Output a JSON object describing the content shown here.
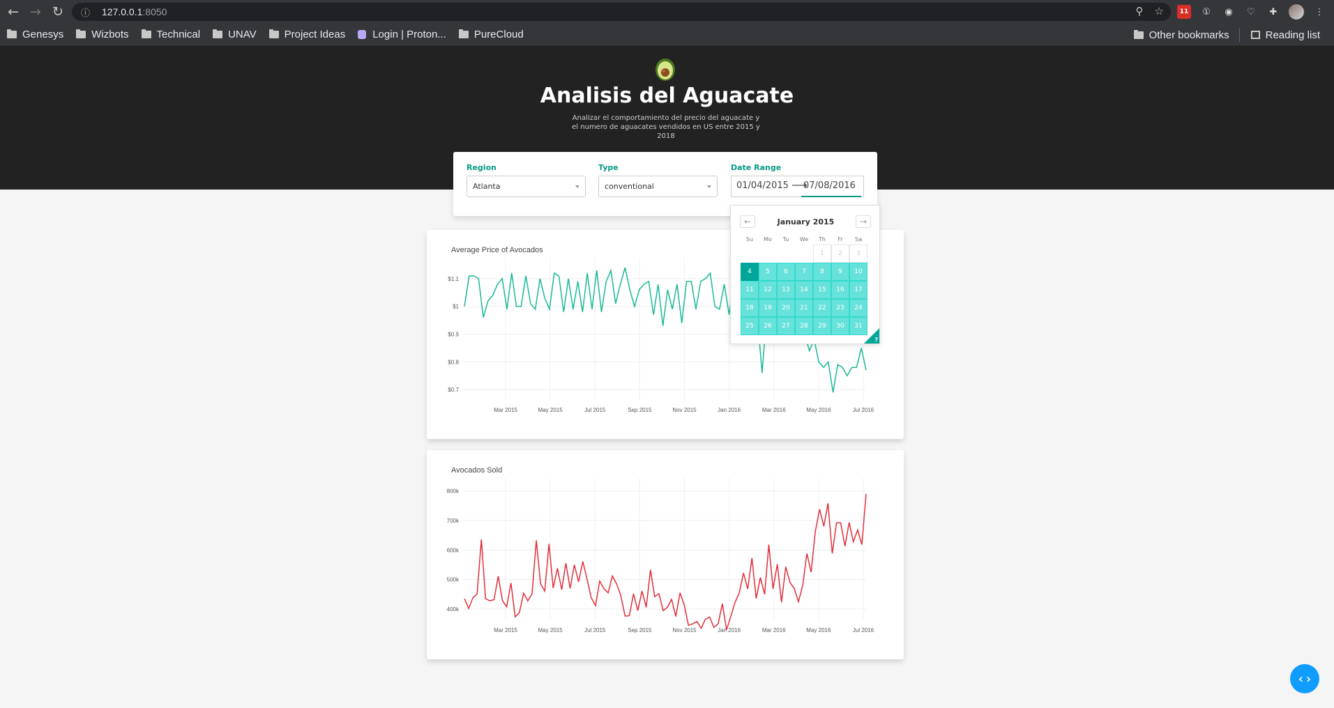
{
  "browser": {
    "url_host": "127.0.0.1",
    "url_port": ":8050",
    "calendar_badge": "11",
    "bookmarks": [
      "Genesys",
      "Wizbots",
      "Technical",
      "UNAV",
      "Project Ideas",
      "Login | Proton...",
      "PureCloud"
    ],
    "other_bookmarks": "Other bookmarks",
    "reading_list": "Reading list"
  },
  "header": {
    "title": "Analisis del Aguacate",
    "description": "Analizar el comportamiento del precio del aguacate y el numero de aguacates vendidos en US entre 2015 y 2018"
  },
  "menu": {
    "region_label": "Region",
    "region_value": "Atlanta",
    "type_label": "Type",
    "type_value": "conventional",
    "date_label": "Date Range",
    "start_date": "01/04/2015",
    "end_date": "07/08/2016"
  },
  "calendar": {
    "month_title": "January 2015",
    "prev_icon": "←",
    "next_icon": "→",
    "weekdays": [
      "Su",
      "Mo",
      "Tu",
      "We",
      "Th",
      "Fr",
      "Sa"
    ],
    "first_weekday_offset": 4,
    "days_in_month": 31,
    "selected_start": 4,
    "help_label": "?"
  },
  "fab_icon": "‹›",
  "chart_data": [
    {
      "type": "line",
      "title": "Average Price of Avocados",
      "color": "#17B897",
      "x_ticks": [
        "Mar 2015",
        "May 2015",
        "Jul 2015",
        "Sep 2015",
        "Nov 2015",
        "Jan 2016",
        "Mar 2016",
        "May 2016",
        "Jul 2016"
      ],
      "y_ticks": [
        "$0.7",
        "$0.8",
        "$0.9",
        "$1",
        "$1.1"
      ],
      "ylim": [
        0.66,
        1.15
      ],
      "values": [
        1.0,
        1.11,
        1.11,
        1.1,
        0.96,
        1.02,
        1.04,
        1.08,
        1.1,
        0.99,
        1.12,
        1.0,
        1.0,
        1.11,
        1.01,
        0.99,
        1.1,
        1.03,
        0.99,
        1.12,
        1.11,
        0.98,
        1.1,
        0.99,
        1.09,
        0.98,
        1.12,
        0.99,
        1.13,
        0.98,
        1.09,
        1.13,
        1.01,
        1.08,
        1.14,
        1.06,
        1.0,
        1.06,
        1.08,
        1.09,
        0.97,
        1.08,
        0.93,
        1.06,
        0.99,
        1.08,
        0.94,
        1.09,
        1.09,
        0.99,
        1.09,
        1.1,
        1.12,
        1.0,
        0.99,
        1.08,
        0.97,
        1.09,
        1.06,
        1.0,
        1.09,
        1.05,
        0.96,
        0.76,
        0.98,
        0.99,
        0.96,
        0.97,
        0.96,
        0.93,
        0.97,
        0.92,
        0.9,
        0.84,
        0.88,
        0.8,
        0.78,
        0.8,
        0.69,
        0.79,
        0.78,
        0.75,
        0.78,
        0.78,
        0.85,
        0.77
      ]
    },
    {
      "type": "line",
      "title": "Avocados Sold",
      "color": "#E12D39",
      "x_ticks": [
        "Mar 2015",
        "May 2015",
        "Jul 2015",
        "Sep 2015",
        "Nov 2015",
        "Jan 2016",
        "Mar 2016",
        "May 2016",
        "Jul 2016"
      ],
      "y_ticks": [
        "400k",
        "500k",
        "600k",
        "700k",
        "800k"
      ],
      "ylim": [
        360000,
        820000
      ],
      "values": [
        435000,
        402000,
        438000,
        452000,
        636000,
        435000,
        428000,
        432000,
        511000,
        428000,
        408000,
        488000,
        374000,
        388000,
        454000,
        428000,
        452000,
        633000,
        486000,
        461000,
        621000,
        471000,
        538000,
        466000,
        555000,
        470000,
        550000,
        492000,
        561000,
        502000,
        438000,
        412000,
        495000,
        469000,
        455000,
        512000,
        485000,
        445000,
        376000,
        378000,
        452000,
        395000,
        461000,
        406000,
        533000,
        442000,
        452000,
        395000,
        406000,
        433000,
        375000,
        455000,
        413000,
        345000,
        350000,
        358000,
        335000,
        366000,
        373000,
        338000,
        350000,
        418000,
        330000,
        375000,
        422000,
        455000,
        522000,
        468000,
        573000,
        436000,
        507000,
        450000,
        618000,
        468000,
        552000,
        423000,
        543000,
        490000,
        470000,
        425000,
        480000,
        588000,
        525000,
        663000,
        738000,
        680000,
        758000,
        588000,
        692000,
        692000,
        613000,
        693000,
        628000,
        668000,
        618000,
        790000
      ]
    }
  ]
}
